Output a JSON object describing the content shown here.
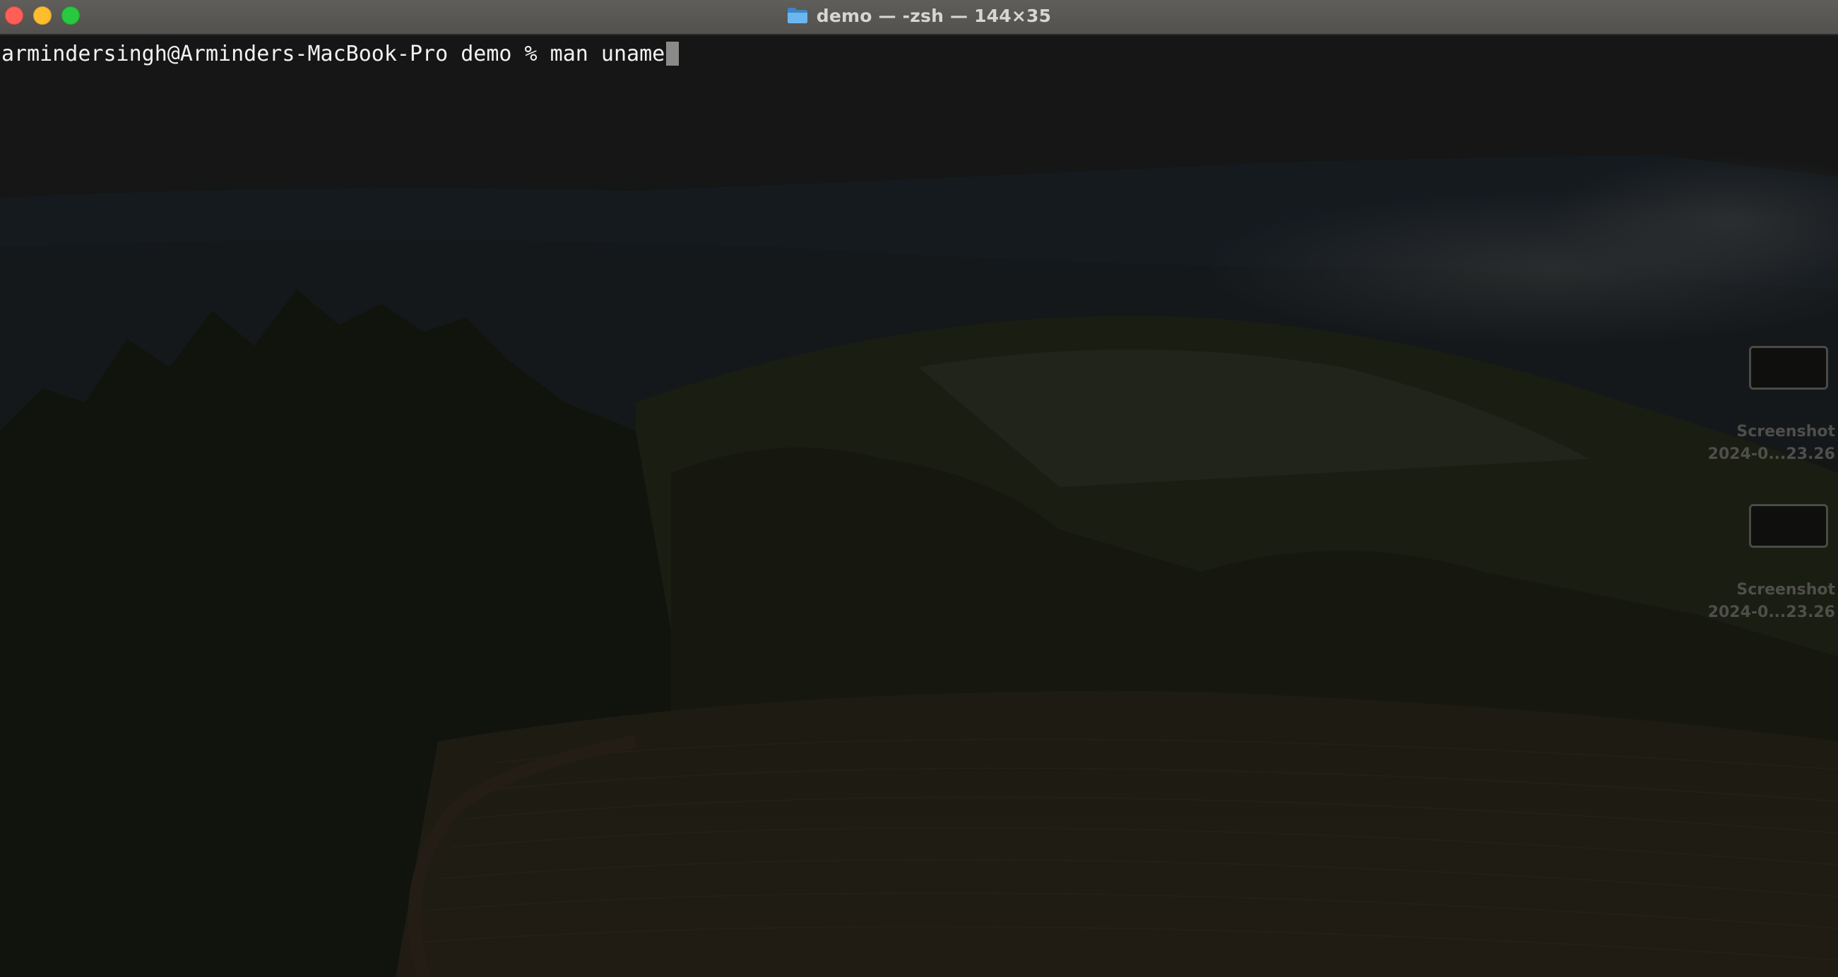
{
  "window": {
    "title": "demo — -zsh — 144×35"
  },
  "terminal": {
    "prompt": "armindersingh@Arminders-MacBook-Pro demo % ",
    "command": "man uname"
  },
  "desktop": {
    "items": [
      {
        "name_line1": "Screenshot",
        "name_line2": "2024-0...23.26"
      },
      {
        "name_line1": "Screenshot",
        "name_line2": "2024-0...23.26"
      }
    ]
  },
  "colors": {
    "close": "#ff5f57",
    "minimize": "#febc2e",
    "maximize": "#28c840",
    "folder": "#5aa7e8"
  }
}
